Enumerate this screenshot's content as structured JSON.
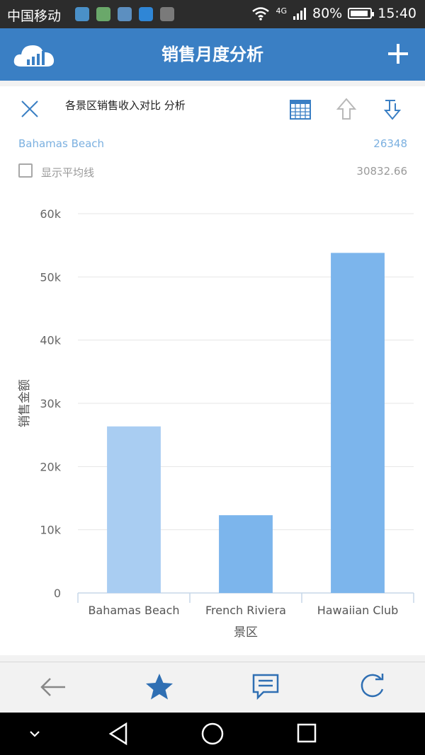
{
  "status_bar": {
    "carrier": "中国移动",
    "network": "4G",
    "battery": "80%",
    "time": "15:40"
  },
  "header": {
    "title": "销售月度分析"
  },
  "chart_panel": {
    "title": "各景区销售收入对比 分析",
    "selected_category": "Bahamas Beach",
    "selected_value": "26348",
    "show_average_label": "显示平均线",
    "average_value": "30832.66",
    "show_average_checked": false
  },
  "chart_data": {
    "type": "bar",
    "title": "各景区销售收入对比 分析",
    "categories": [
      "Bahamas Beach",
      "French Riviera",
      "Hawaiian Club"
    ],
    "values": [
      26348,
      12300,
      53800
    ],
    "xlabel": "景区",
    "ylabel": "销售金额",
    "ylim": [
      0,
      60000
    ],
    "yticks": [
      0,
      10000,
      20000,
      30000,
      40000,
      50000,
      60000
    ],
    "ytick_labels": [
      "0",
      "10k",
      "20k",
      "30k",
      "40k",
      "50k",
      "60k"
    ],
    "grid": true,
    "bar_colors": [
      "#a9cdf2",
      "#7cb5ec",
      "#7cb5ec"
    ],
    "selected_index": 0
  },
  "colors": {
    "accent": "#3a7fc4",
    "bar": "#7cb5ec",
    "bar_selected": "#a9cdf2",
    "link": "#7bb0e0"
  },
  "toolbar": {
    "icons": [
      "back-arrow-icon",
      "star-icon",
      "comment-icon",
      "refresh-icon"
    ]
  }
}
